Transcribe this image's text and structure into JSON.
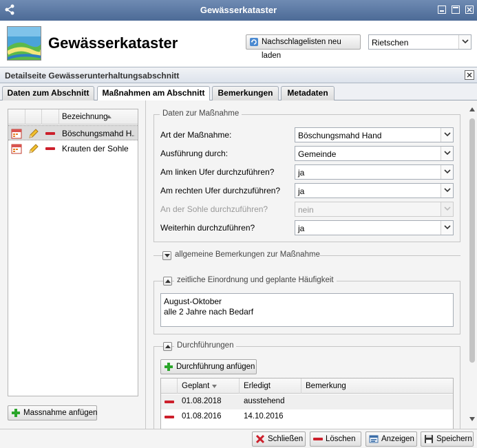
{
  "window": {
    "title": "Gewässerkataster"
  },
  "header": {
    "app_title": "Gewässerkataster",
    "reload_button": "Nachschlagelisten neu laden",
    "location_select": "Rietschen"
  },
  "panel": {
    "title": "Detailseite Gewässerunterhaltungsabschnitt"
  },
  "tabs": [
    {
      "label": "Daten zum Abschnitt"
    },
    {
      "label": "Maßnahmen am Abschnitt"
    },
    {
      "label": "Bemerkungen"
    },
    {
      "label": "Metadaten"
    }
  ],
  "measures_grid": {
    "column": "Bezeichnung",
    "rows": [
      {
        "label": "Böschungsmahd H..."
      },
      {
        "label": "Krauten der Sohle"
      }
    ],
    "add_button": "Massnahme anfügen"
  },
  "details": {
    "legend": "Daten zur Maßnahme",
    "fields": [
      {
        "label": "Art der Maßnahme:",
        "value": "Böschungsmahd Hand"
      },
      {
        "label": "Ausführung durch:",
        "value": "Gemeinde"
      },
      {
        "label": "Am linken Ufer durchzuführen?",
        "value": "ja"
      },
      {
        "label": "Am rechten Ufer durchzuführen?",
        "value": "ja"
      },
      {
        "label": "An der Sohle durchzuführen?",
        "value": "nein"
      },
      {
        "label": "Weiterhin durchzuführen?",
        "value": "ja"
      }
    ]
  },
  "general_remarks": {
    "legend": "allgemeine Bemerkungen zur Maßnahme"
  },
  "schedule": {
    "legend": "zeitliche Einordnung und geplante Häufigkeit",
    "text": "August-Oktober\nalle 2 Jahre nach Bedarf"
  },
  "executions": {
    "legend": "Durchführungen",
    "add_button": "Durchführung anfügen",
    "columns": [
      "Geplant",
      "Erledigt",
      "Bemerkung"
    ],
    "rows": [
      {
        "planned": "01.08.2018",
        "done": "ausstehend",
        "note": ""
      },
      {
        "planned": "01.08.2016",
        "done": "14.10.2016",
        "note": ""
      }
    ]
  },
  "footer": {
    "close": "Schließen",
    "delete": "Löschen",
    "show": "Anzeigen",
    "save": "Speichern"
  },
  "colors": {
    "titlebar": "#5a779f",
    "delete_red": "#cc1f2b",
    "add_green": "#2aa52a"
  }
}
